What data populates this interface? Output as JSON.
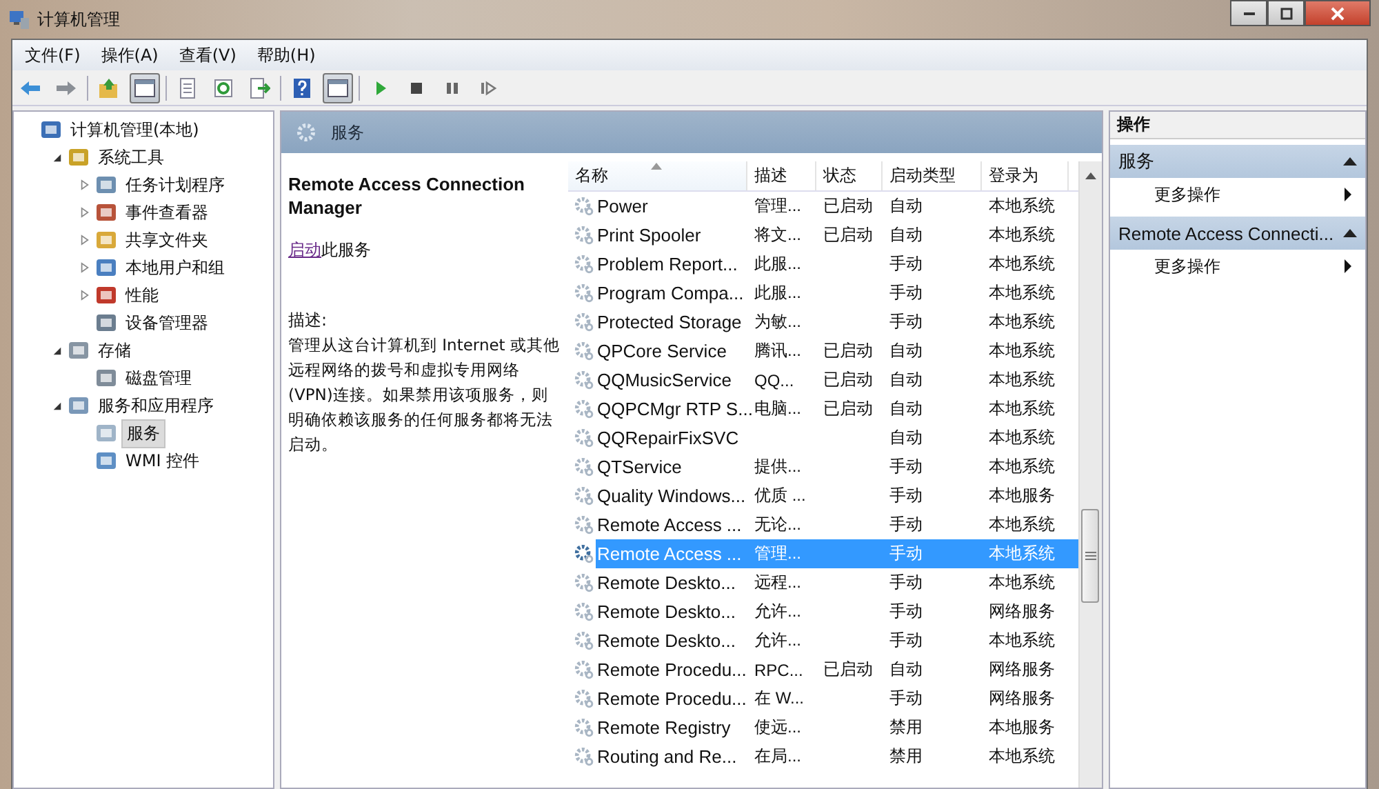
{
  "window": {
    "title": "计算机管理"
  },
  "menu": [
    "文件(F)",
    "操作(A)",
    "查看(V)",
    "帮助(H)"
  ],
  "toolbar": [
    {
      "on": false
    },
    {
      "on": false
    },
    {
      "on": false
    },
    {
      "on": true
    },
    {
      "on": false
    },
    {
      "on": false
    },
    {
      "on": false
    },
    {
      "on": false
    },
    {
      "on": true
    },
    {
      "on": false
    },
    {
      "on": false
    },
    {
      "on": false
    },
    {
      "on": false
    }
  ],
  "tree": [
    {
      "label": "计算机管理(本地)",
      "selected": false,
      "children": [
        {
          "label": "系统工具",
          "expanded": true,
          "selected": false,
          "children": [
            {
              "label": "任务计划程序",
              "expanded": false,
              "selected": false
            },
            {
              "label": "事件查看器",
              "expanded": false,
              "selected": false
            },
            {
              "label": "共享文件夹",
              "expanded": false,
              "selected": false
            },
            {
              "label": "本地用户和组",
              "expanded": false,
              "selected": false
            },
            {
              "label": "性能",
              "expanded": false,
              "selected": false
            },
            {
              "label": "设备管理器",
              "selected": false
            }
          ]
        },
        {
          "label": "存储",
          "expanded": true,
          "selected": false,
          "children": [
            {
              "label": "磁盘管理",
              "selected": false
            }
          ]
        },
        {
          "label": "服务和应用程序",
          "expanded": true,
          "selected": false,
          "children": [
            {
              "label": "服务",
              "selected": true
            },
            {
              "label": "WMI 控件",
              "selected": false
            }
          ]
        }
      ]
    }
  ],
  "panel": {
    "title": "服务",
    "service_name": "Remote Access Connection Manager",
    "action_link": "启动",
    "action_text": "此服务",
    "description_label": "描述:",
    "description": "管理从这台计算机到 Internet 或其他远程网络的拨号和虚拟专用网络(VPN)连接。如果禁用该项服务，则明确依赖该服务的任何服务都将无法启动。"
  },
  "table": {
    "columns": [
      {
        "label": "名称",
        "sorted": true
      },
      {
        "label": "描述",
        "sorted": false
      },
      {
        "label": "状态",
        "sorted": false
      },
      {
        "label": "启动类型",
        "sorted": false
      },
      {
        "label": "登录为",
        "sorted": false
      }
    ],
    "rows": [
      {
        "cells": [
          "Power",
          "管理...",
          "已启动",
          "自动",
          "本地系统"
        ],
        "selected": false
      },
      {
        "cells": [
          "Print Spooler",
          "将文...",
          "已启动",
          "自动",
          "本地系统"
        ],
        "selected": false
      },
      {
        "cells": [
          "Problem Report...",
          "此服...",
          "",
          "手动",
          "本地系统"
        ],
        "selected": false
      },
      {
        "cells": [
          "Program Compa...",
          "此服...",
          "",
          "手动",
          "本地系统"
        ],
        "selected": false
      },
      {
        "cells": [
          "Protected Storage",
          "为敏...",
          "",
          "手动",
          "本地系统"
        ],
        "selected": false
      },
      {
        "cells": [
          "QPCore Service",
          "腾讯...",
          "已启动",
          "自动",
          "本地系统"
        ],
        "selected": false
      },
      {
        "cells": [
          "QQMusicService",
          "QQ...",
          "已启动",
          "自动",
          "本地系统"
        ],
        "selected": false
      },
      {
        "cells": [
          "QQPCMgr RTP S...",
          "电脑...",
          "已启动",
          "自动",
          "本地系统"
        ],
        "selected": false
      },
      {
        "cells": [
          "QQRepairFixSVC",
          "",
          "",
          "自动",
          "本地系统"
        ],
        "selected": false
      },
      {
        "cells": [
          "QTService",
          "提供...",
          "",
          "手动",
          "本地系统"
        ],
        "selected": false
      },
      {
        "cells": [
          "Quality Windows...",
          "优质 ...",
          "",
          "手动",
          "本地服务"
        ],
        "selected": false
      },
      {
        "cells": [
          "Remote Access ...",
          "无论...",
          "",
          "手动",
          "本地系统"
        ],
        "selected": false
      },
      {
        "cells": [
          "Remote Access ...",
          "管理...",
          "",
          "手动",
          "本地系统"
        ],
        "selected": true
      },
      {
        "cells": [
          "Remote Deskto...",
          "远程...",
          "",
          "手动",
          "本地系统"
        ],
        "selected": false
      },
      {
        "cells": [
          "Remote Deskto...",
          "允许...",
          "",
          "手动",
          "网络服务"
        ],
        "selected": false
      },
      {
        "cells": [
          "Remote Deskto...",
          "允许...",
          "",
          "手动",
          "本地系统"
        ],
        "selected": false
      },
      {
        "cells": [
          "Remote Procedu...",
          "RPC...",
          "已启动",
          "自动",
          "网络服务"
        ],
        "selected": false
      },
      {
        "cells": [
          "Remote Procedu...",
          "在 W...",
          "",
          "手动",
          "网络服务"
        ],
        "selected": false
      },
      {
        "cells": [
          "Remote Registry",
          "使远...",
          "",
          "禁用",
          "本地服务"
        ],
        "selected": false
      },
      {
        "cells": [
          "Routing and Re...",
          "在局...",
          "",
          "禁用",
          "本地系统"
        ],
        "selected": false
      }
    ]
  },
  "actions": {
    "title": "操作",
    "sections": [
      {
        "title": "服务",
        "expanded": true,
        "items": [
          "更多操作"
        ]
      },
      {
        "title": "Remote Access Connecti...",
        "expanded": true,
        "items": [
          "更多操作"
        ]
      }
    ]
  }
}
